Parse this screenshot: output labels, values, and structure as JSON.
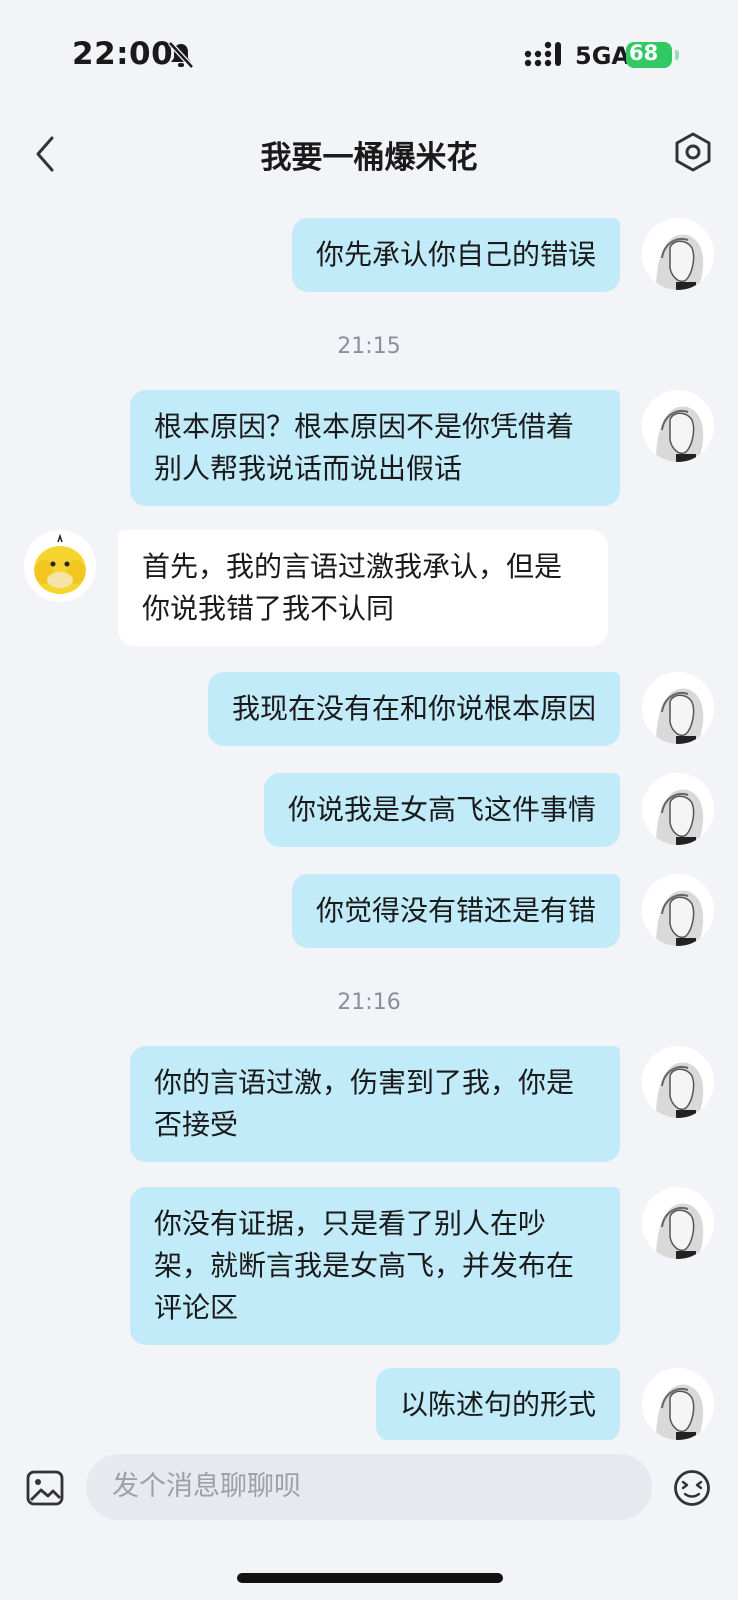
{
  "status_bar": {
    "time": "22:00",
    "network": "5GA",
    "battery": "68"
  },
  "header": {
    "title": "我要一桶爆米花"
  },
  "messages": [
    {
      "side": "right",
      "text": "你先承认你自己的错误"
    },
    {
      "timestamp": "21:15"
    },
    {
      "side": "right",
      "text": "根本原因？根本原因不是你凭借着别人帮我说话而说出假话"
    },
    {
      "side": "left",
      "text": "首先，我的言语过激我承认，但是你说我错了我不认同"
    },
    {
      "side": "right",
      "text": "我现在没有在和你说根本原因"
    },
    {
      "side": "right",
      "text": "你说我是女高飞这件事情"
    },
    {
      "side": "right",
      "text": "你觉得没有错还是有错"
    },
    {
      "timestamp": "21:16"
    },
    {
      "side": "right",
      "text": "你的言语过激，伤害到了我，你是否接受"
    },
    {
      "side": "right",
      "text": "你没有证据，只是看了别人在吵架，就断言我是女高飞，并发布在评论区"
    },
    {
      "side": "right",
      "text": "以陈述句的形式"
    }
  ],
  "composer": {
    "placeholder": "发个消息聊聊呗"
  },
  "colors": {
    "outgoing_bubble": "#c2ebfa",
    "incoming_bubble": "#ffffff",
    "background": "#f3f4f7",
    "battery": "#32c864"
  },
  "icons": {
    "back": "chevron-left-icon",
    "settings": "hexagon-settings-icon",
    "image": "image-icon",
    "emoji": "emoji-icon",
    "bell": "bell-muted-icon"
  }
}
